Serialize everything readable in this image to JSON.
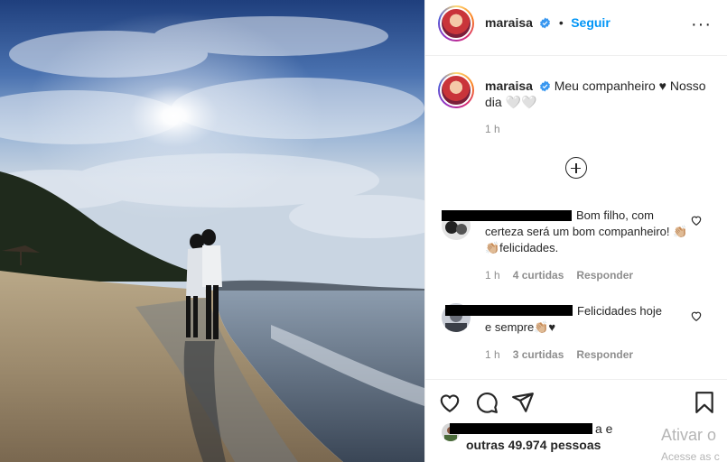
{
  "post": {
    "username": "maraisa",
    "separator": "•",
    "follow_label": "Seguir",
    "more_label": "···",
    "caption": "Meu companheiro ♥ Nosso dia 🤍🤍",
    "caption_time": "1 h"
  },
  "comments": [
    {
      "text_line1": "Bom filho, com",
      "text_rest": "certeza será um bom companheiro! 👏🏼👏🏼felicidades.",
      "time": "1 h",
      "likes": "4 curtidas",
      "reply_label": "Responder"
    },
    {
      "text_line1": "Felicidades hoje",
      "text_rest": "e sempre👏🏼♥",
      "time": "1 h",
      "likes": "3 curtidas",
      "reply_label": "Responder"
    }
  ],
  "likes": {
    "connector": "a e",
    "others": "outras 49.974 pessoas"
  },
  "watermark": {
    "title": "Ativar o",
    "subtitle": "Acesse as c"
  },
  "colors": {
    "accent_blue": "#0095f6",
    "verified_blue": "#3897f0",
    "text": "#262626",
    "muted": "#8e8e8e"
  },
  "icons": [
    "verified-badge-icon",
    "more-options-icon",
    "load-more-comments-icon",
    "heart-icon",
    "comment-icon",
    "share-icon",
    "save-icon"
  ]
}
